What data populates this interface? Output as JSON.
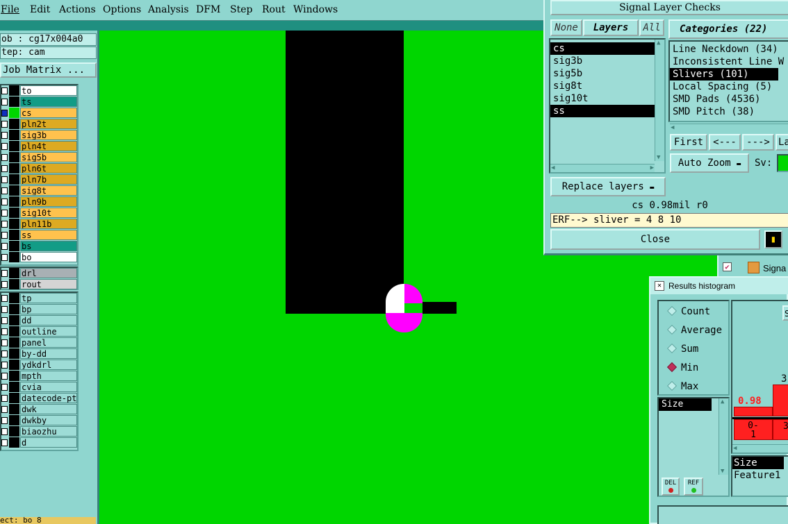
{
  "menu": {
    "items": [
      "File",
      "Edit",
      "Actions",
      "Options",
      "Analysis",
      "DFM",
      "Step",
      "Rout",
      "Windows"
    ]
  },
  "left_panel": {
    "job_line": "ob : cg17x004a0",
    "step_line": "tep: cam",
    "job_matrix_label": "Job Matrix ...",
    "board_layers": [
      {
        "name": "to",
        "color": "#ffffff",
        "mark": "⬈"
      },
      {
        "name": "ts",
        "color": "#129c86",
        "mark": ""
      },
      {
        "name": "cs",
        "color": "#ffc24d",
        "mark": "⊞"
      },
      {
        "name": "pln2t",
        "color": "#ddaa22",
        "mark": ""
      },
      {
        "name": "sig3b",
        "color": "#ffc24d",
        "mark": ""
      },
      {
        "name": "pln4t",
        "color": "#ddaa22",
        "mark": ""
      },
      {
        "name": "sig5b",
        "color": "#ffc24d",
        "mark": ""
      },
      {
        "name": "pln6t",
        "color": "#ddaa22",
        "mark": ""
      },
      {
        "name": "pln7b",
        "color": "#ddaa22",
        "mark": ""
      },
      {
        "name": "sig8t",
        "color": "#ffc24d",
        "mark": ""
      },
      {
        "name": "pln9b",
        "color": "#ddaa22",
        "mark": ""
      },
      {
        "name": "sig10t",
        "color": "#ffc24d",
        "mark": ""
      },
      {
        "name": "pln11b",
        "color": "#ddaa22",
        "mark": ""
      },
      {
        "name": "ss",
        "color": "#ffc24d",
        "mark": ""
      },
      {
        "name": "bs",
        "color": "#129c86",
        "mark": ""
      },
      {
        "name": "bo",
        "color": "#ffffff",
        "mark": "⬈"
      }
    ],
    "drill_layers": [
      {
        "name": "drl",
        "color": "#a8b0b4",
        "mark": ""
      },
      {
        "name": "rout",
        "color": "#d4d4d4",
        "mark": ""
      }
    ],
    "misc_layers": [
      {
        "name": "tp",
        "color": "#9ddcd6",
        "mark": ""
      },
      {
        "name": "bp",
        "color": "#9ddcd6",
        "mark": ""
      },
      {
        "name": "dd",
        "color": "#9ddcd6",
        "mark": "⬈"
      },
      {
        "name": "outline",
        "color": "#9ddcd6",
        "mark": ""
      },
      {
        "name": "panel",
        "color": "#9ddcd6",
        "mark": ""
      },
      {
        "name": "by-dd",
        "color": "#9ddcd6",
        "mark": ""
      },
      {
        "name": "ydkdrl",
        "color": "#9ddcd6",
        "mark": ""
      },
      {
        "name": "mpth",
        "color": "#9ddcd6",
        "mark": ""
      },
      {
        "name": "cvia",
        "color": "#9ddcd6",
        "mark": ""
      },
      {
        "name": "datecode-pt",
        "color": "#9ddcd6",
        "mark": ""
      },
      {
        "name": "dwk",
        "color": "#9ddcd6",
        "mark": ""
      },
      {
        "name": "dwkby",
        "color": "#9ddcd6",
        "mark": ""
      },
      {
        "name": "biaozhu",
        "color": "#9ddcd6",
        "mark": ""
      },
      {
        "name": "d",
        "color": "#9ddcd6",
        "mark": ""
      }
    ],
    "bottom_text": "ect: bo 8"
  },
  "signal_layer_checks": {
    "title": "Signal Layer Checks",
    "none_label": "None",
    "layers_label": "Layers",
    "all_label": "All",
    "categories_label": "Categories (22)",
    "layer_list": [
      {
        "name": "cs",
        "selected": true
      },
      {
        "name": "sig3b",
        "selected": false
      },
      {
        "name": "sig5b",
        "selected": false
      },
      {
        "name": "sig8t",
        "selected": false
      },
      {
        "name": "sig10t",
        "selected": false
      },
      {
        "name": "ss",
        "selected": true
      }
    ],
    "category_list": [
      {
        "name": "Line Neckdown (34)",
        "selected": false
      },
      {
        "name": "Inconsistent Line W",
        "selected": false
      },
      {
        "name": "Slivers (101)",
        "selected": true
      },
      {
        "name": "Local Spacing (5)",
        "selected": false
      },
      {
        "name": "SMD Pads (4536)",
        "selected": false
      },
      {
        "name": "SMD Pitch (38)",
        "selected": false
      }
    ],
    "nav": {
      "first": "First",
      "prev": "<---",
      "next": "--->",
      "last": "La"
    },
    "auto_zoom_label": "Auto Zoom",
    "sv_label": "Sv:",
    "replace_layers_label": "Replace layers",
    "status": "cs 0.98mil  r0",
    "erf": "ERF--> sliver = 4 8 10",
    "close_label": "Close"
  },
  "behind_window_title": "Signa",
  "results_histogram": {
    "title": "Results histogram",
    "modes": [
      {
        "label": "Count",
        "selected": false
      },
      {
        "label": "Average",
        "selected": false
      },
      {
        "label": "Sum",
        "selected": false
      },
      {
        "label": "Min",
        "selected": true
      },
      {
        "label": "Max",
        "selected": false
      }
    ],
    "attr_list": [
      "Size"
    ],
    "del_label": "DEL",
    "ref_label": "REF",
    "bar_label_low": "0.98",
    "bar_label_high": "3.",
    "bin_label_1": "0-\n1",
    "bin_label_2": "3",
    "attr_list_2": [
      "Size",
      "Feature1"
    ],
    "top_button": "S"
  },
  "colors": {
    "canvas": "#00d600",
    "feature": "#000000",
    "highlight": "#ff00ff",
    "panel": "#8fd6cf",
    "accent_red": "#ff2020"
  }
}
